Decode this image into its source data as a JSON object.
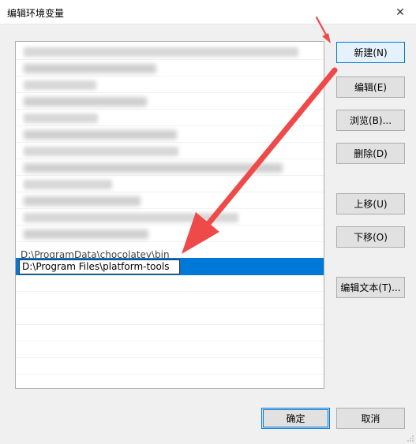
{
  "window": {
    "title": "编辑环境变量",
    "close_glyph": "✕"
  },
  "list": {
    "partial_entry": "D:\\ProgramData\\chocolatey\\bin",
    "editing_value": "D:\\Program Files\\platform-tools"
  },
  "buttons": {
    "new": "新建(N)",
    "edit": "编辑(E)",
    "browse": "浏览(B)...",
    "delete": "删除(D)",
    "move_up": "上移(U)",
    "move_down": "下移(O)",
    "edit_text": "编辑文本(T)...",
    "ok": "确定",
    "cancel": "取消"
  },
  "colors": {
    "selection": "#0078d7",
    "annotation_arrow": "#ef4a4a"
  },
  "icons": {
    "close": "close-icon",
    "annotation": "red-arrow-annotation"
  }
}
